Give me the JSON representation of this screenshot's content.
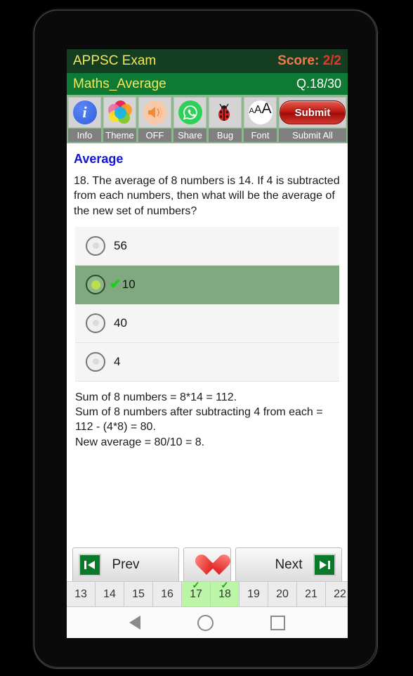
{
  "header": {
    "app_title": "APPSC Exam",
    "score_label": "Score: ",
    "score_value": "2/2",
    "subject": "Maths_Average",
    "question_counter": "Q.18/30"
  },
  "toolbar": {
    "buttons": [
      {
        "icon": "info-icon",
        "label": "Info"
      },
      {
        "icon": "theme-palette-icon",
        "label": "Theme"
      },
      {
        "icon": "speaker-icon",
        "label": "OFF"
      },
      {
        "icon": "whatsapp-share-icon",
        "label": "Share"
      },
      {
        "icon": "ladybug-icon",
        "label": "Bug"
      },
      {
        "icon": "font-size-icon",
        "label": "Font"
      }
    ],
    "submit_button": "Submit",
    "submit_all_label": "Submit All"
  },
  "main": {
    "category": "Average",
    "question": "18. The average of 8 numbers is 14. If 4 is subtracted from each numbers, then what will be the average of the new set of numbers?",
    "options": [
      {
        "text": "56",
        "selected": false
      },
      {
        "text": "10",
        "selected": true
      },
      {
        "text": "40",
        "selected": false
      },
      {
        "text": "4",
        "selected": false
      }
    ],
    "explanation": "Sum of 8 numbers = 8*14 = 112.\nSum of 8 numbers after subtracting 4 from each = 112 - (4*8) = 80.\nNew average = 80/10 = 8."
  },
  "bottom_nav": {
    "prev_label": "Prev",
    "next_label": "Next",
    "favorite_icon": "heart-icon",
    "prev_icon": "skip-to-start-icon",
    "next_icon": "skip-to-end-icon"
  },
  "question_strip": [
    {
      "num": "13",
      "done": false
    },
    {
      "num": "14",
      "done": false
    },
    {
      "num": "15",
      "done": false
    },
    {
      "num": "16",
      "done": false
    },
    {
      "num": "17",
      "done": true
    },
    {
      "num": "18",
      "done": true
    },
    {
      "num": "19",
      "done": false
    },
    {
      "num": "20",
      "done": false
    },
    {
      "num": "21",
      "done": false
    },
    {
      "num": "22",
      "done": false
    }
  ],
  "android_nav": {
    "back": "back-icon",
    "home": "home-icon",
    "recents": "recents-icon"
  },
  "colors": {
    "titlebar": "#143d22",
    "subbar": "#0e7a33",
    "accent_yellow": "#f2e85c",
    "score_red": "#e8342b",
    "category_blue": "#1414d4",
    "selected_option": "#80a97f",
    "done_cell": "#bdf5a8",
    "submit_red": "#c21a12"
  }
}
